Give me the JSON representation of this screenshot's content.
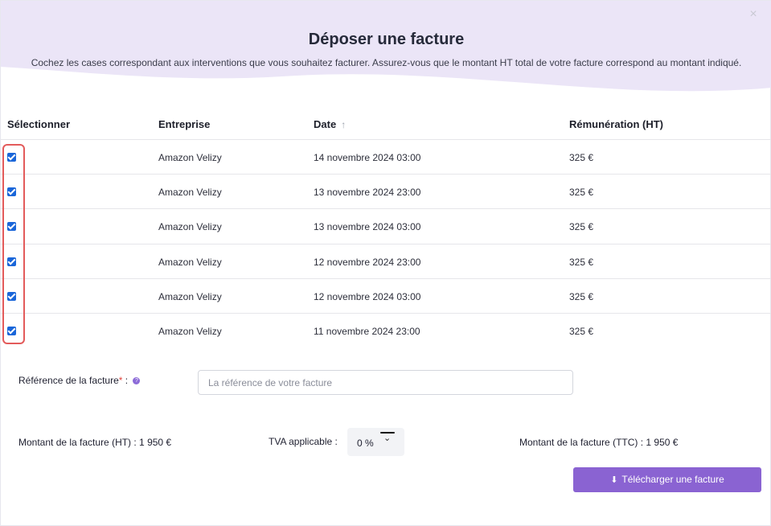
{
  "modal": {
    "title": "Déposer une facture",
    "subtitle": "Cochez les cases correspondant aux interventions que vous souhaitez facturer. Assurez-vous que le montant HT total de votre facture correspond au montant indiqué.",
    "close_icon": "×"
  },
  "table": {
    "headers": {
      "select": "Sélectionner",
      "company": "Entreprise",
      "date": "Date",
      "date_sort_icon": "↑",
      "pay": "Rémunération (HT)"
    },
    "rows": [
      {
        "checked": true,
        "company": "Amazon Velizy",
        "date": "14 novembre 2024 03:00",
        "amount": "325 €"
      },
      {
        "checked": true,
        "company": "Amazon Velizy",
        "date": "13 novembre 2024 23:00",
        "amount": "325 €"
      },
      {
        "checked": true,
        "company": "Amazon Velizy",
        "date": "13 novembre 2024 03:00",
        "amount": "325 €"
      },
      {
        "checked": true,
        "company": "Amazon Velizy",
        "date": "12 novembre 2024 23:00",
        "amount": "325 €"
      },
      {
        "checked": true,
        "company": "Amazon Velizy",
        "date": "12 novembre 2024 03:00",
        "amount": "325 €"
      },
      {
        "checked": true,
        "company": "Amazon Velizy",
        "date": "11 novembre 2024 23:00",
        "amount": "325 €"
      }
    ]
  },
  "form": {
    "reference_label": "Référence de la facture",
    "required_mark": "*",
    "colon": " :",
    "reference_placeholder": "La référence de votre facture",
    "reference_value": "",
    "ht_amount": "Montant de la facture (HT) : 1 950 €",
    "tva_label": "TVA applicable :",
    "tva_value": "0 %",
    "ttc_amount": "Montant de la facture (TTC) : 1 950 €",
    "upload_label": "Télécharger une facture"
  },
  "colors": {
    "header_bg": "#ebe5f7",
    "accent": "#8a63d2",
    "checkbox": "#1a66d9",
    "highlight": "#e35b5b"
  },
  "icons": {
    "close": "close-icon",
    "sort": "arrow-up-icon",
    "help": "question-icon",
    "chevron": "chevron-down-icon",
    "download": "download-icon"
  }
}
